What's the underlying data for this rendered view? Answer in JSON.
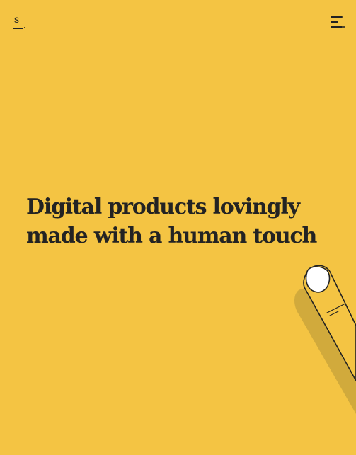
{
  "header": {
    "logo_letter": "s",
    "logo_icon": "logo-mark",
    "menu_icon": "hamburger-menu-icon"
  },
  "hero": {
    "headline_line1": "Digital products lovingly",
    "headline_line2": "made with a human touch"
  },
  "colors": {
    "background": "#F4C443",
    "text": "#232323",
    "finger_shadow": "#D1AA3C",
    "nail": "#FFFFFF"
  }
}
